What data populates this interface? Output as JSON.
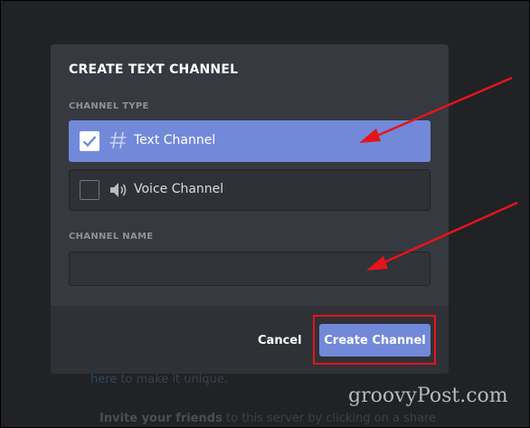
{
  "modal": {
    "title": "CREATE TEXT CHANNEL",
    "channel_type_label": "CHANNEL TYPE",
    "channel_name_label": "CHANNEL NAME",
    "options": [
      {
        "label": "Text Channel",
        "selected": true,
        "icon": "hash-icon"
      },
      {
        "label": "Voice Channel",
        "selected": false,
        "icon": "speaker-icon"
      }
    ],
    "channel_name_value": "",
    "cancel_label": "Cancel",
    "create_label": "Create Channel"
  },
  "background": {
    "line1_link": "here",
    "line1_text": "to make it unique.",
    "line2_bold": "Invite your friends",
    "line2_text": "to this server by clicking on a share"
  },
  "watermark": "groovyPost.com",
  "colors": {
    "accent": "#7289da",
    "modal_bg": "#36393f",
    "footer_bg": "#2f3136",
    "annotation_red": "#e5141b"
  }
}
